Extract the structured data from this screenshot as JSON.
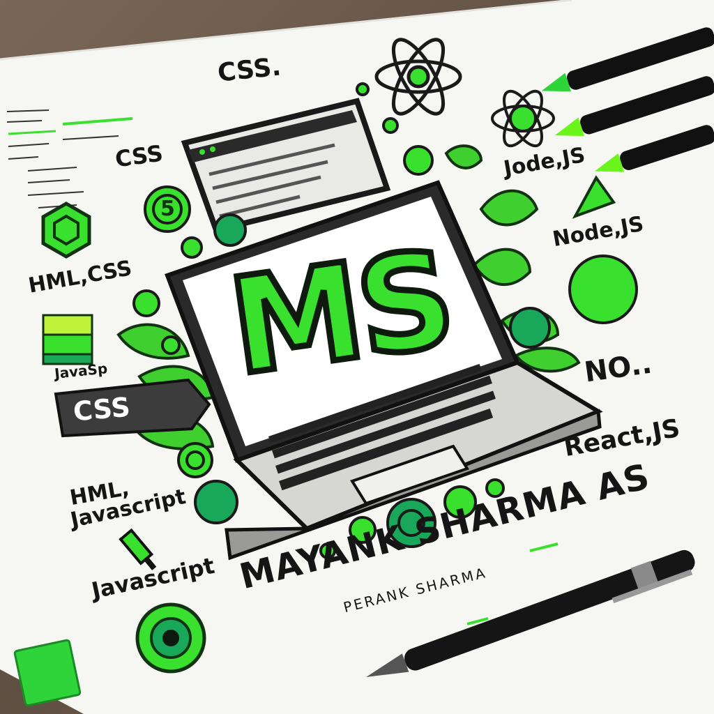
{
  "labels": {
    "css_top": "CSS.",
    "css_left": "CSS",
    "hml_css": "HML,CSS",
    "javasp": "JavaSp",
    "css_tag": "CSS",
    "hml": "HML,",
    "javascript_1": "Javascript",
    "javascript_2": "Javascript",
    "jode_js": "Jode,JS",
    "node_js": "Node,JS",
    "no": "NO..",
    "react_js": "React,JS",
    "ms_logo": "MS",
    "name_big": "MAYANK SHARMA AS",
    "name_small": "PERANK SHARMA",
    "coin_5": "5"
  },
  "colors": {
    "accent": "#39e02e",
    "dark": "#151515",
    "paper": "#f6f6f3"
  }
}
